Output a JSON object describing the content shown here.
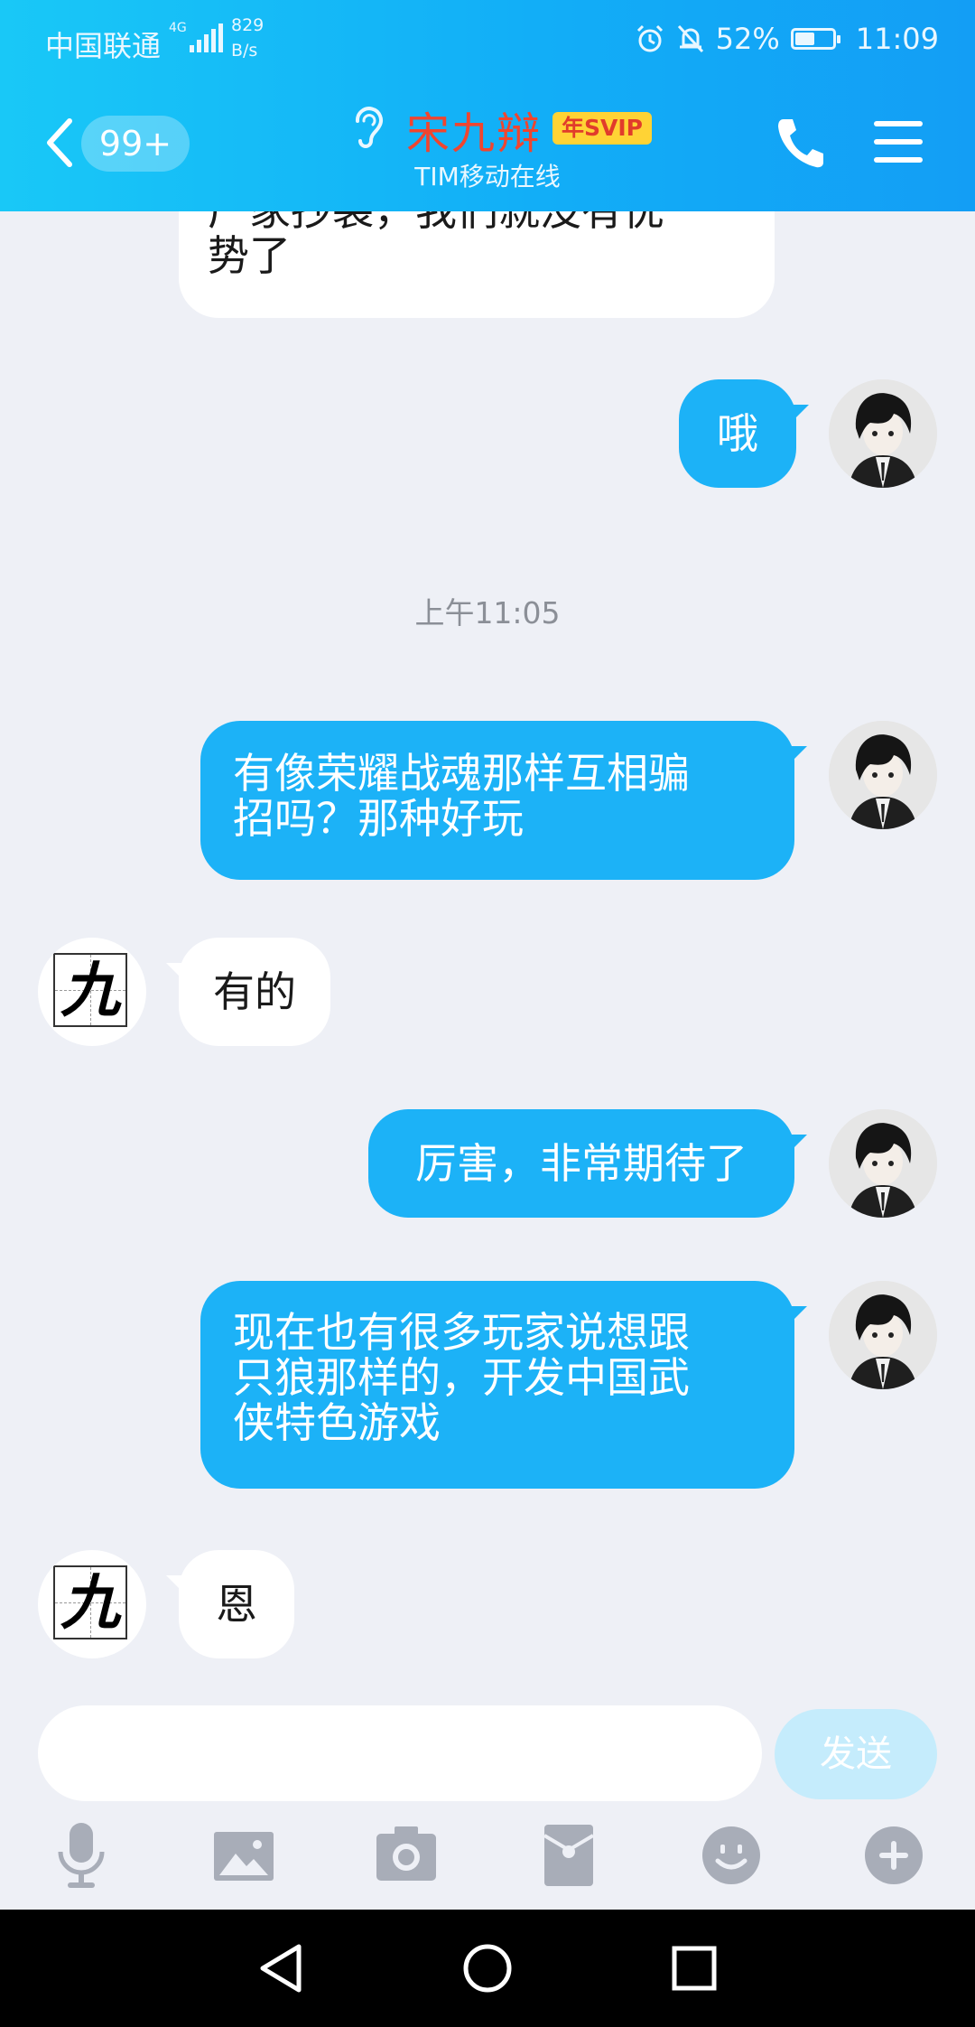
{
  "status_bar": {
    "carrier": "中国联通",
    "network": "4G",
    "speed_value": "829",
    "speed_unit": "B/s",
    "battery": "52%",
    "battery_level": 0.52,
    "time": "11:09"
  },
  "header": {
    "unread_badge": "99+",
    "contact_name": "宋九辩",
    "vip_badge": "年SVIP",
    "online_status": "TIM移动在线"
  },
  "messages": [
    {
      "side": "in",
      "lines": [
        "厂家抄袭，我们就没有优",
        "势了"
      ]
    },
    {
      "side": "out",
      "text": "哦"
    },
    {
      "type": "timestamp",
      "text": "上午11:05"
    },
    {
      "side": "out",
      "lines": [
        "有像荣耀战魂那样互相骗",
        "招吗？那种好玩"
      ]
    },
    {
      "side": "in",
      "text": "有的",
      "avatar_char": "九"
    },
    {
      "side": "out",
      "text": "厉害，非常期待了"
    },
    {
      "side": "out",
      "lines": [
        "现在也有很多玩家说想跟",
        "只狼那样的，开发中国武",
        "侠特色游戏"
      ]
    },
    {
      "side": "in",
      "text": "恩",
      "avatar_char": "九"
    }
  ],
  "input": {
    "value": "",
    "send_label": "发送"
  },
  "toolbar_icons": [
    "microphone-icon",
    "image-icon",
    "camera-icon",
    "red-packet-icon",
    "emoji-icon",
    "plus-icon"
  ],
  "colors": {
    "header": "#12aef7",
    "outgoing_bubble": "#1cb2f7",
    "incoming_bubble": "#ffffff",
    "name": "#f0452f",
    "svip": "#ffd335"
  }
}
